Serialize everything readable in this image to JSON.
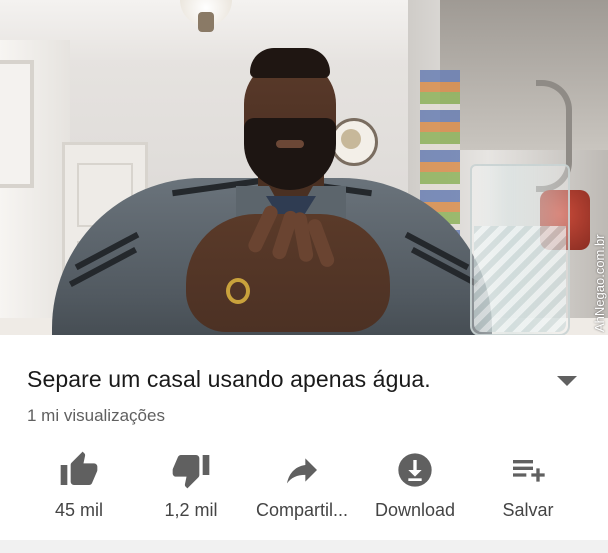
{
  "video": {
    "watermark": "AhNegao.com.br"
  },
  "info": {
    "title": "Separe um casal usando apenas água.",
    "views": "1 mi visualizações"
  },
  "actions": {
    "like_label": "45 mil",
    "dislike_label": "1,2 mil",
    "share_label": "Compartil...",
    "download_label": "Download",
    "save_label": "Salvar"
  },
  "colors": {
    "icon": "#606060",
    "text": "#1a1a1a",
    "secondary_text": "#606060"
  }
}
